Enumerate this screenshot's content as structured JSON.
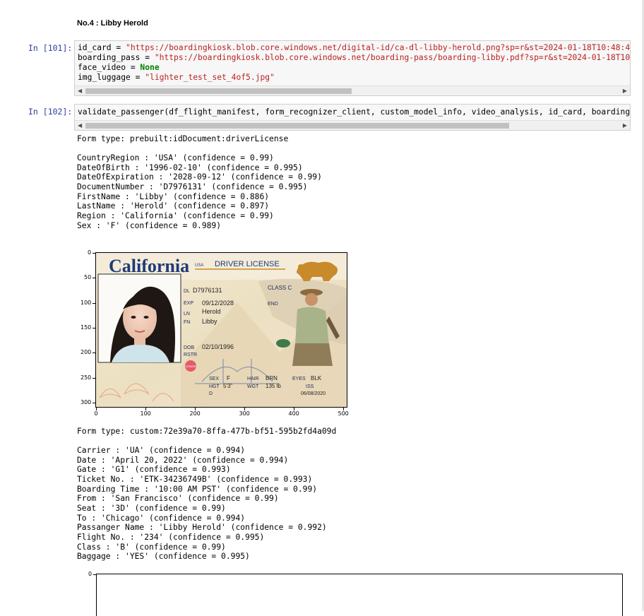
{
  "section_title": "No.4 : Libby Herold",
  "cell1": {
    "prompt": "In [101]:",
    "line1_var": "id_card",
    "line1_str": "\"https://boardingkiosk.blob.core.windows.net/digital-id/ca-dl-libby-herold.png?sp=r&st=2024-01-18T10:48:49",
    "line2_var": "boarding_pass",
    "line2_str": "\"https://boardingkiosk.blob.core.windows.net/boarding-pass/boarding-libby.pdf?sp=r&st=2024-01-18T10:",
    "line3_var": "face_video",
    "line3_kw": "None",
    "line4_var": "img_luggage",
    "line4_str": "\"lighter_test_set_4of5.jpg\""
  },
  "cell2": {
    "prompt": "In [102]:",
    "code": "validate_passenger(df_flight_manifest, form_recognizer_client, custom_model_info, video_analysis, id_card, boarding_"
  },
  "output1": {
    "form_type": "Form type: prebuilt:idDocument:driverLicense",
    "fields": [
      "CountryRegion : 'USA' (confidence = 0.99)",
      "DateOfBirth : '1996-02-10' (confidence = 0.995)",
      "DateOfExpiration : '2028-09-12' (confidence = 0.99)",
      "DocumentNumber : 'D7976131' (confidence = 0.995)",
      "FirstName : 'Libby' (confidence = 0.886)",
      "LastName : 'Herold' (confidence = 0.897)",
      "Region : 'California' (confidence = 0.99)",
      "Sex : 'F' (confidence = 0.989)"
    ]
  },
  "license_plot": {
    "y_ticks": [
      "0",
      "50",
      "100",
      "150",
      "200",
      "250",
      "300"
    ],
    "x_ticks": [
      "0",
      "100",
      "200",
      "300",
      "400",
      "500"
    ],
    "card": {
      "state": "California",
      "usa": "USA",
      "doc_type": "DRIVER LICENSE",
      "dl_label": "DL",
      "dl": "D7976131",
      "class_label": "CLASS C",
      "exp_label": "EXP",
      "exp": "09/12/2028",
      "end_label": "END",
      "ln_label": "LN",
      "ln": "Herold",
      "fn_label": "FN",
      "fn": "Libby",
      "dob_label": "DOB",
      "dob": "02/10/1996",
      "rstr_label": "RSTR",
      "donor": "DONOR",
      "sex_label": "SEX",
      "sex": "F",
      "hair_label": "HAIR",
      "hair": "BRN",
      "eyes_label": "EYES",
      "eyes": "BLK",
      "hgt_label": "HGT",
      "hgt": "5'3\"",
      "wgt_label": "WGT",
      "wgt": "135 lb",
      "iss_label": "ISS",
      "iss": "06/08/2020",
      "d_label": "D"
    }
  },
  "output2": {
    "form_type": "Form type: custom:72e39a70-8ffa-477b-bf51-595b2fd4a09d",
    "fields": [
      "Carrier : 'UA' (confidence = 0.994)",
      "Date : 'April 20, 2022' (confidence = 0.994)",
      "Gate : 'G1' (confidence = 0.993)",
      "Ticket No. : 'ETK-34236749B' (confidence = 0.993)",
      "Boarding Time : '10:00 AM PST' (confidence = 0.99)",
      "From : 'San Francisco' (confidence = 0.99)",
      "Seat : '3D' (confidence = 0.99)",
      "To : 'Chicago' (confidence = 0.994)",
      "Passanger Name : 'Libby Herold' (confidence = 0.992)",
      "Flight No. : '234' (confidence = 0.995)",
      "Class : 'B' (confidence = 0.99)",
      "Baggage : 'YES' (confidence = 0.995)"
    ]
  },
  "pass_plot": {
    "y_ticks": [
      "0"
    ]
  },
  "colors": {
    "prompt": "#303f9f",
    "string": "#ba2121",
    "keyword": "#008000",
    "california": "#1f3a7a",
    "card_bg": "#f1e6cf"
  }
}
